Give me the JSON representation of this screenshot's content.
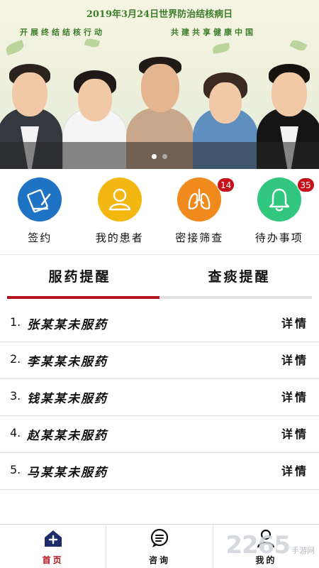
{
  "banner": {
    "title": "2019年3月24日世界防治结核病日",
    "slogan_left": "开展终结结核行动",
    "slogan_right": "共建共享健康中国",
    "dots": 2,
    "active_dot": 0
  },
  "actions": [
    {
      "label": "签约",
      "icon": "contract-icon",
      "color": "#1f73c4",
      "badge": ""
    },
    {
      "label": "我的患者",
      "icon": "user-icon",
      "color": "#f3b712",
      "badge": ""
    },
    {
      "label": "密接筛查",
      "icon": "lungs-icon",
      "color": "#f08a1c",
      "badge": "14"
    },
    {
      "label": "待办事项",
      "icon": "bell-icon",
      "color": "#32c77f",
      "badge": "35"
    }
  ],
  "tabs": [
    {
      "label": "服药提醒",
      "active": true
    },
    {
      "label": "查痰提醒",
      "active": false
    }
  ],
  "list": [
    {
      "num": "1.",
      "name": "张某某未服药",
      "detail": "详情"
    },
    {
      "num": "2.",
      "name": "李某某未服药",
      "detail": "详情"
    },
    {
      "num": "3.",
      "name": "钱某某未服药",
      "detail": "详情"
    },
    {
      "num": "4.",
      "name": "赵某某未服药",
      "detail": "详情"
    },
    {
      "num": "5.",
      "name": "马某某未服药",
      "detail": "详情"
    }
  ],
  "nav": [
    {
      "label": "首页",
      "icon": "home-icon",
      "active": true
    },
    {
      "label": "咨询",
      "icon": "chat-icon",
      "active": false
    },
    {
      "label": "我的",
      "icon": "profile-icon",
      "active": false
    }
  ],
  "watermark": {
    "number": "2265",
    "text": "手游网"
  },
  "colors": {
    "accent": "#b3141c",
    "badge": "#c8101b",
    "banner_text": "#3c7d2a"
  }
}
